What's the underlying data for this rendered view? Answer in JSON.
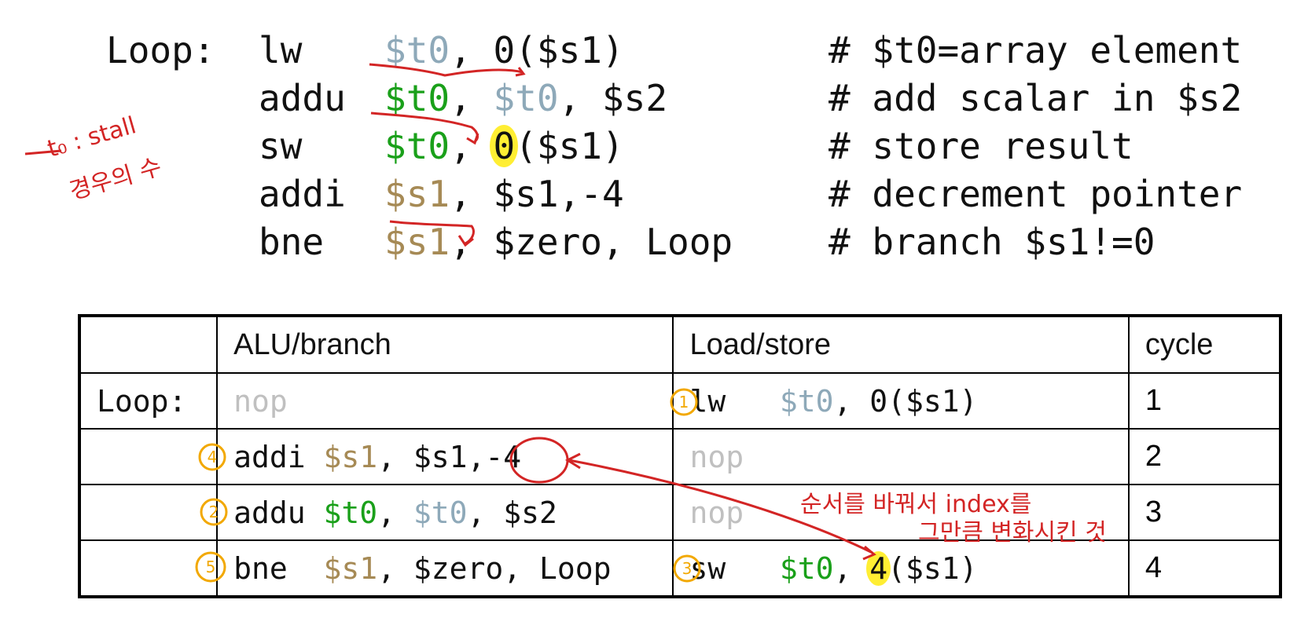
{
  "code": {
    "lines": [
      {
        "label": "Loop:",
        "op": "lw",
        "args": [
          {
            "t": "$t0",
            "c": "teal"
          },
          {
            "t": ", "
          },
          {
            "t": "0",
            "c": ""
          },
          {
            "t": "($s1)"
          }
        ],
        "comment": "# $t0=array element"
      },
      {
        "label": "",
        "op": "addu",
        "args": [
          {
            "t": "$t0",
            "c": "green"
          },
          {
            "t": ", "
          },
          {
            "t": "$t0",
            "c": "teal"
          },
          {
            "t": ", $s2"
          }
        ],
        "comment": "# add scalar in $s2"
      },
      {
        "label": "",
        "op": "sw",
        "args": [
          {
            "t": "$t0",
            "c": "green"
          },
          {
            "t": ", "
          },
          {
            "t": "0",
            "c": "hl"
          },
          {
            "t": "($s1)"
          }
        ],
        "comment": "# store result"
      },
      {
        "label": "",
        "op": "addi",
        "args": [
          {
            "t": "$s1",
            "c": "brown"
          },
          {
            "t": ", $s1,-4"
          }
        ],
        "comment": "# decrement pointer"
      },
      {
        "label": "",
        "op": "bne",
        "args": [
          {
            "t": "$s1",
            "c": "brown"
          },
          {
            "t": ", $zero, Loop"
          }
        ],
        "comment": "# branch $s1!=0"
      }
    ]
  },
  "table": {
    "headers": [
      "",
      "ALU/branch",
      "Load/store",
      "cycle"
    ],
    "rows": [
      {
        "label": "Loop:",
        "alu": [
          {
            "t": "nop",
            "c": "gray"
          }
        ],
        "ls": [
          {
            "t": "lw   "
          },
          {
            "t": "$t0",
            "c": "teal"
          },
          {
            "t": ", 0($s1)"
          }
        ],
        "cycle": "1"
      },
      {
        "label": "",
        "alu": [
          {
            "t": "addi "
          },
          {
            "t": "$s1",
            "c": "brown"
          },
          {
            "t": ", $s1,-4"
          }
        ],
        "ls": [
          {
            "t": "nop",
            "c": "gray"
          }
        ],
        "cycle": "2"
      },
      {
        "label": "",
        "alu": [
          {
            "t": "addu "
          },
          {
            "t": "$t0",
            "c": "green"
          },
          {
            "t": ", "
          },
          {
            "t": "$t0",
            "c": "teal"
          },
          {
            "t": ", $s2"
          }
        ],
        "ls": [
          {
            "t": "nop",
            "c": "gray"
          }
        ],
        "cycle": "3"
      },
      {
        "label": "",
        "alu": [
          {
            "t": "bne  "
          },
          {
            "t": "$s1",
            "c": "brown"
          },
          {
            "t": ", $zero, Loop"
          }
        ],
        "ls": [
          {
            "t": "sw   "
          },
          {
            "t": "$t0",
            "c": "green"
          },
          {
            "t": ", "
          },
          {
            "t": "4",
            "c": "hl"
          },
          {
            "t": "($s1)"
          }
        ],
        "cycle": "4"
      }
    ]
  },
  "annotations": {
    "stall_note": "t₀ : stall",
    "stall_note_2": "경우의 수",
    "index_note": "순서를 바꿔서 index를",
    "index_note_2": "그만큼 변화시킨 것",
    "circled_numbers": [
      "1",
      "4",
      "2",
      "5",
      "3"
    ]
  },
  "colors": {
    "teal": "#8ea9b9",
    "green": "#1aa01a",
    "brown": "#a68a55",
    "gray": "#c0c0c0",
    "highlight": "#ffee33",
    "pen_red": "#d32525",
    "pen_orange": "#f2a800"
  }
}
